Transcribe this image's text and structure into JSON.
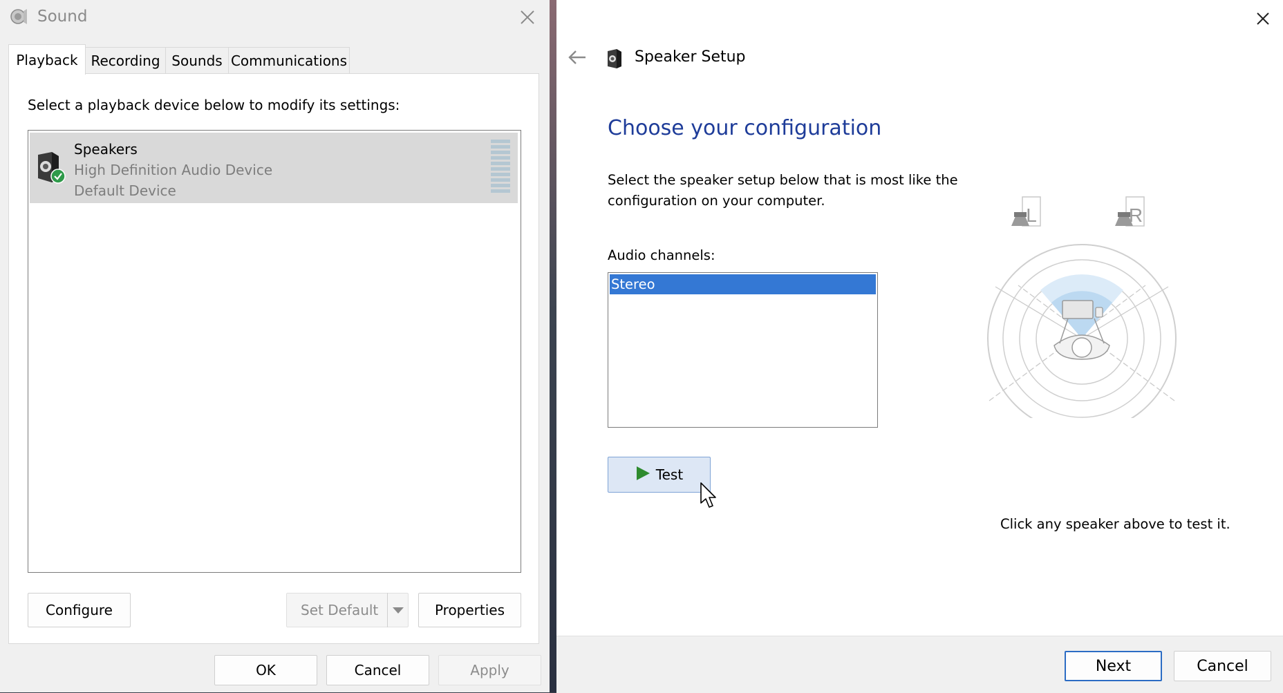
{
  "sound_window": {
    "title": "Sound",
    "tabs": [
      {
        "label": "Playback",
        "active": true
      },
      {
        "label": "Recording",
        "active": false
      },
      {
        "label": "Sounds",
        "active": false
      },
      {
        "label": "Communications",
        "active": false
      }
    ],
    "instruction": "Select a playback device below to modify its settings:",
    "devices": [
      {
        "name": "Speakers",
        "description": "High Definition Audio Device",
        "status": "Default Device",
        "icon": "speaker-icon",
        "badge": "default-check-icon"
      }
    ],
    "buttons": {
      "configure": "Configure",
      "set_default": "Set Default",
      "properties": "Properties",
      "ok": "OK",
      "cancel": "Cancel",
      "apply": "Apply"
    }
  },
  "speaker_setup": {
    "title": "Speaker Setup",
    "heading": "Choose your configuration",
    "description": "Select the speaker setup below that is most like the configuration on your computer.",
    "channels_label": "Audio channels:",
    "channels": [
      {
        "label": "Stereo",
        "selected": true
      }
    ],
    "test_button": "Test",
    "speaker_left_label": "L",
    "speaker_right_label": "R",
    "hint": "Click any speaker above to test it.",
    "next_button": "Next",
    "cancel_button": "Cancel"
  },
  "colors": {
    "heading": "#1e3c99",
    "selection": "#3478d4",
    "play": "#2e8b2e",
    "default_check": "#2e9a4a"
  }
}
